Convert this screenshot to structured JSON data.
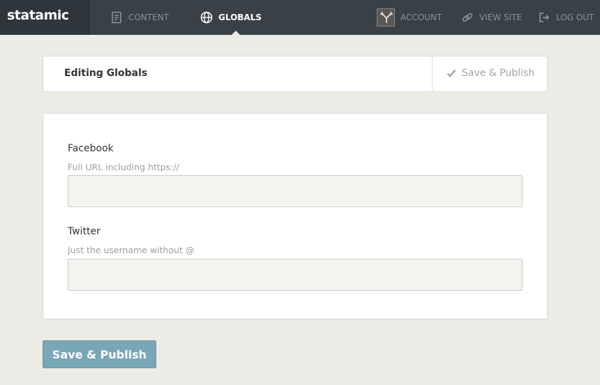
{
  "app": {
    "logo": "statamic"
  },
  "nav": {
    "content_label": "CONTENT",
    "globals_label": "GLOBALS",
    "account_label": "ACCOUNT",
    "view_site_label": "VIEW SITE",
    "log_out_label": "LOG OUT",
    "active_item": "GLOBALS"
  },
  "header": {
    "title": "Editing Globals",
    "save_label": "Save & Publish"
  },
  "form": {
    "fields": [
      {
        "label": "Facebook",
        "help": "Full URL including https://",
        "value": ""
      },
      {
        "label": "Twitter",
        "help": "Just the username without @",
        "value": ""
      }
    ]
  },
  "footer": {
    "save_label": "Save & Publish"
  },
  "colors": {
    "topbar": "#394147",
    "background": "#ecece6",
    "primary_button": "#7aa7b8"
  },
  "icons": {
    "content": "document-icon",
    "globals": "globe-icon",
    "view_site": "link-icon",
    "log_out": "sign-out-icon",
    "header_save": "checkmark-icon"
  }
}
